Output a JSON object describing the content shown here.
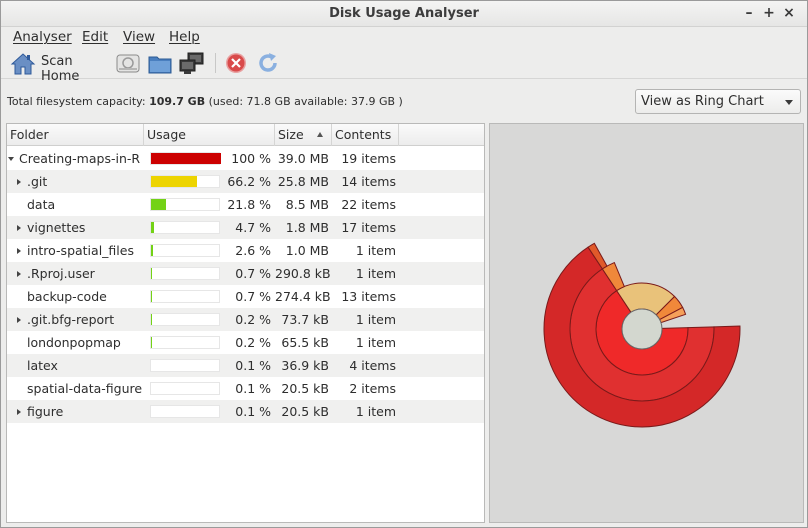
{
  "window": {
    "title": "Disk Usage Analyser",
    "minimize": "–",
    "maximize": "+",
    "close": "×"
  },
  "menu": [
    "Analyser",
    "Edit",
    "View",
    "Help"
  ],
  "toolbar": {
    "scan_home_label": "Scan Home",
    "icons": [
      "home-icon",
      "scan-filesystem-icon",
      "scan-folder-icon",
      "scan-remote-icon",
      "stop-icon",
      "refresh-icon"
    ]
  },
  "info": {
    "prefix": "Total filesystem capacity:",
    "capacity": "109.7 GB",
    "detail": "(used: 71.8 GB available: 37.9 GB )"
  },
  "view_select": {
    "value": "View as Ring Chart"
  },
  "tree": {
    "columns": [
      "Folder",
      "Usage",
      "Size",
      "Contents"
    ],
    "rows": [
      {
        "name": "Creating-maps-in-R",
        "pct": "100 %",
        "size": "39.0 MB",
        "items": "19 items",
        "usage": 1.0,
        "color": "#cc0000",
        "expander": "open",
        "depth": 0
      },
      {
        "name": ".git",
        "pct": "66.2 %",
        "size": "25.8 MB",
        "items": "14 items",
        "usage": 0.662,
        "color": "#edd400",
        "expander": "closed",
        "depth": 1
      },
      {
        "name": "data",
        "pct": "21.8 %",
        "size": "8.5 MB",
        "items": "22 items",
        "usage": 0.218,
        "color": "#73d216",
        "expander": "none",
        "depth": 1
      },
      {
        "name": "vignettes",
        "pct": "4.7 %",
        "size": "1.8 MB",
        "items": "17 items",
        "usage": 0.047,
        "color": "#73d216",
        "expander": "closed",
        "depth": 1
      },
      {
        "name": "intro-spatial_files",
        "pct": "2.6 %",
        "size": "1.0 MB",
        "items": "1 item",
        "usage": 0.026,
        "color": "#73d216",
        "expander": "closed",
        "depth": 1
      },
      {
        "name": ".Rproj.user",
        "pct": "0.7 %",
        "size": "290.8 kB",
        "items": "1 item",
        "usage": 0.007,
        "color": "#73d216",
        "expander": "closed",
        "depth": 1
      },
      {
        "name": "backup-code",
        "pct": "0.7 %",
        "size": "274.4 kB",
        "items": "13 items",
        "usage": 0.007,
        "color": "#73d216",
        "expander": "none",
        "depth": 1
      },
      {
        "name": ".git.bfg-report",
        "pct": "0.2 %",
        "size": "73.7 kB",
        "items": "1 item",
        "usage": 0.002,
        "color": "#73d216",
        "expander": "closed",
        "depth": 1
      },
      {
        "name": "londonpopmap",
        "pct": "0.2 %",
        "size": "65.5 kB",
        "items": "1 item",
        "usage": 0.002,
        "color": "#73d216",
        "expander": "none",
        "depth": 1
      },
      {
        "name": "latex",
        "pct": "0.1 %",
        "size": "36.9 kB",
        "items": "4 items",
        "usage": 0.001,
        "color": "#73d216",
        "expander": "none",
        "depth": 1
      },
      {
        "name": "spatial-data-figure",
        "pct": "0.1 %",
        "size": "20.5 kB",
        "items": "2 items",
        "usage": 0.001,
        "color": "#73d216",
        "expander": "none",
        "depth": 1
      },
      {
        "name": "figure",
        "pct": "0.1 %",
        "size": "20.5 kB",
        "items": "1 item",
        "usage": 0.001,
        "color": "#73d216",
        "expander": "closed",
        "depth": 1
      }
    ]
  },
  "ring_chart": {
    "center_color": "#d3d7cf",
    "ring_colors": [
      "#e8a73c",
      "#ef2929",
      "#cc0000"
    ],
    "segments": [
      {
        "ring": 1,
        "share": 0.662,
        "color": "#ef2929"
      },
      {
        "ring": 1,
        "share": 0.218,
        "color": "#e9c27a"
      },
      {
        "ring": 1,
        "share": 0.047,
        "color": "#f0883a"
      },
      {
        "ring": 1,
        "share": 0.026,
        "color": "#f5a05a"
      },
      {
        "ring": 2,
        "share": 0.662,
        "color": "#e03030"
      },
      {
        "ring": 2,
        "share": 0.03,
        "color": "#f0883a"
      },
      {
        "ring": 3,
        "share": 0.662,
        "color": "#d42828"
      },
      {
        "ring": 3,
        "share": 0.012,
        "color": "#e05a2a"
      }
    ]
  }
}
